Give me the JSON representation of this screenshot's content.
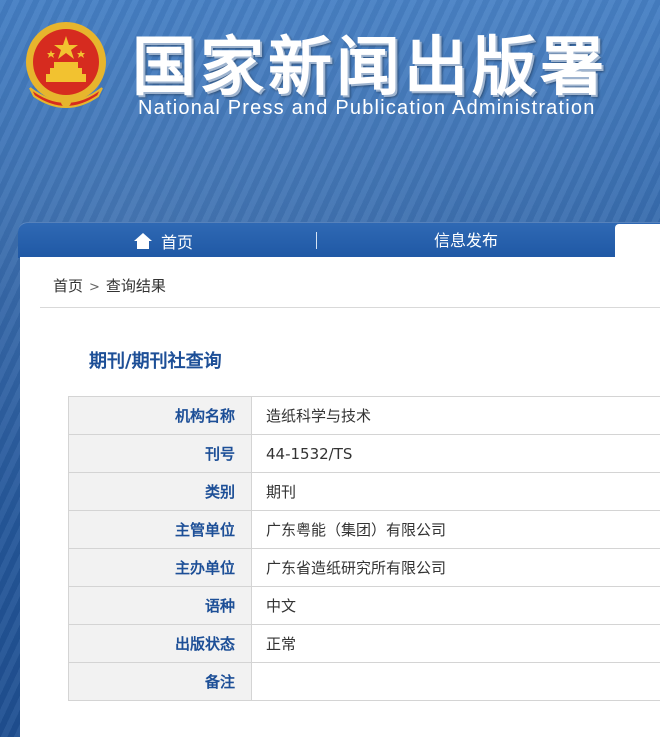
{
  "header": {
    "title_cn": "国家新闻出版署",
    "title_en": "National  Press and Publication Administration"
  },
  "nav": {
    "home_label": "首页",
    "info_label": "信息发布"
  },
  "breadcrumb": {
    "home": "首页",
    "separator": ">",
    "current": "查询结果"
  },
  "section_title": "期刊/期刊社查询",
  "rows": [
    {
      "label": "机构名称",
      "value": "造纸科学与技术"
    },
    {
      "label": "刊号",
      "value": "44-1532/TS"
    },
    {
      "label": "类别",
      "value": "期刊"
    },
    {
      "label": "主管单位",
      "value": "广东粤能（集团）有限公司"
    },
    {
      "label": "主办单位",
      "value": "广东省造纸研究所有限公司"
    },
    {
      "label": "语种",
      "value": "中文"
    },
    {
      "label": "出版状态",
      "value": "正常"
    },
    {
      "label": "备注",
      "value": ""
    }
  ],
  "colors": {
    "brand_blue": "#1d4f97",
    "emblem_red": "#d62b1f",
    "emblem_gold": "#f2c230"
  }
}
